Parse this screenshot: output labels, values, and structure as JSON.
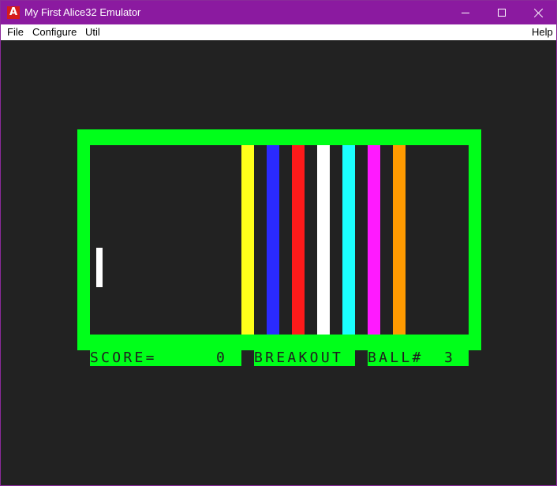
{
  "window": {
    "title": "My First Alice32 Emulator",
    "icon_letter": "A"
  },
  "menu": {
    "file": "File",
    "configure": "Configure",
    "util": "Util",
    "help": "Help"
  },
  "game": {
    "score_label": "SCORE=",
    "score_value": "0",
    "title": "BREAKOUT",
    "ball_label": "BALL#",
    "ball_value": "3",
    "colors": {
      "border": "#00ff1a",
      "bricks": [
        "#ffff1a",
        "#2a2aff",
        "#ff1a1a",
        "#ffffff",
        "#1affff",
        "#ff1aff",
        "#ff9a00"
      ]
    }
  }
}
